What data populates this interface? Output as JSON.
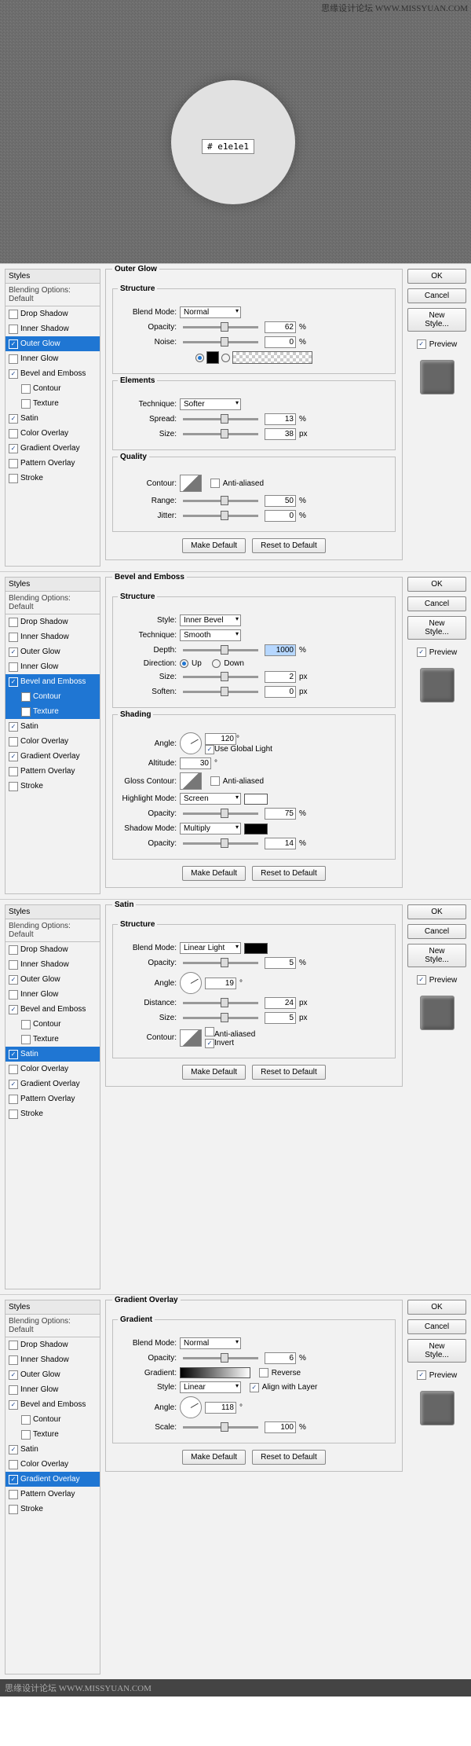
{
  "watermark": "思缘设计论坛  WWW.MISSYUAN.COM",
  "footer_watermark": "思缘设计论坛 WWW.MISSYUAN.COM",
  "hex_label": "# e1e1e1",
  "common": {
    "styles_header": "Styles",
    "blending_default": "Blending Options: Default",
    "ok": "OK",
    "cancel": "Cancel",
    "new_style": "New Style...",
    "preview": "Preview",
    "make_default": "Make Default",
    "reset_default": "Reset to Default",
    "structure": "Structure",
    "blend_mode": "Blend Mode:",
    "opacity": "Opacity:",
    "pct": "%",
    "px": "px",
    "deg": "°",
    "anti_aliased": "Anti-aliased",
    "angle": "Angle:",
    "size": "Size:",
    "contour": "Contour:"
  },
  "styles_list": [
    {
      "label": "Drop Shadow",
      "on": false
    },
    {
      "label": "Inner Shadow",
      "on": false
    },
    {
      "label": "Outer Glow",
      "on": true
    },
    {
      "label": "Inner Glow",
      "on": false
    },
    {
      "label": "Bevel and Emboss",
      "on": true
    },
    {
      "label": "Contour",
      "on": false,
      "indent": true
    },
    {
      "label": "Texture",
      "on": false,
      "indent": true
    },
    {
      "label": "Satin",
      "on": true
    },
    {
      "label": "Color Overlay",
      "on": false
    },
    {
      "label": "Gradient Overlay",
      "on": true
    },
    {
      "label": "Pattern Overlay",
      "on": false
    },
    {
      "label": "Stroke",
      "on": false
    }
  ],
  "panel1": {
    "title": "Outer Glow",
    "selected_index": 2,
    "blend_mode_val": "Normal",
    "opacity_val": "62",
    "noise_lbl": "Noise:",
    "noise_val": "0",
    "elements": "Elements",
    "technique_lbl": "Technique:",
    "technique_val": "Softer",
    "spread_lbl": "Spread:",
    "spread_val": "13",
    "size_val": "38",
    "quality": "Quality",
    "range_lbl": "Range:",
    "range_val": "50",
    "jitter_lbl": "Jitter:",
    "jitter_val": "0"
  },
  "panel2": {
    "title": "Bevel and Emboss",
    "selected_index": 4,
    "sub_sel": [
      5,
      6
    ],
    "style_lbl": "Style:",
    "style_val": "Inner Bevel",
    "technique_lbl": "Technique:",
    "technique_val": "Smooth",
    "depth_lbl": "Depth:",
    "depth_val": "1000",
    "direction_lbl": "Direction:",
    "up": "Up",
    "down": "Down",
    "size_val": "2",
    "soften_lbl": "Soften:",
    "soften_val": "0",
    "shading": "Shading",
    "angle_val": "120",
    "ugl": "Use Global Light",
    "altitude_lbl": "Altitude:",
    "altitude_val": "30",
    "gloss_lbl": "Gloss Contour:",
    "hl_mode_lbl": "Highlight Mode:",
    "hl_mode_val": "Screen",
    "hl_op_val": "75",
    "sh_mode_lbl": "Shadow Mode:",
    "sh_mode_val": "Multiply",
    "sh_op_val": "14"
  },
  "panel3": {
    "title": "Satin",
    "selected_index": 7,
    "blend_mode_val": "Linear Light",
    "opacity_val": "5",
    "angle_val": "19",
    "distance_lbl": "Distance:",
    "distance_val": "24",
    "size_val": "5",
    "invert": "Invert"
  },
  "panel4": {
    "title": "Gradient Overlay",
    "selected_index": 9,
    "gradient_legend": "Gradient",
    "blend_mode_val": "Normal",
    "opacity_val": "6",
    "gradient_lbl": "Gradient:",
    "reverse": "Reverse",
    "style_lbl": "Style:",
    "style_val": "Linear",
    "align": "Align with Layer",
    "angle_val": "118",
    "scale_lbl": "Scale:",
    "scale_val": "100"
  }
}
